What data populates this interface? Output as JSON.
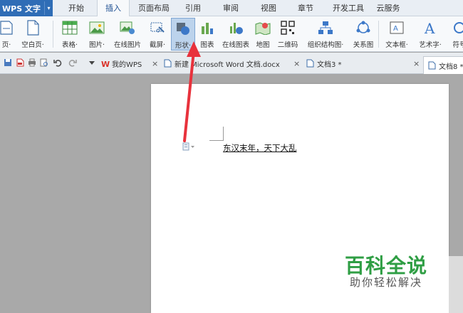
{
  "app": {
    "title": "WPS 文字"
  },
  "menu_tabs": [
    "开始",
    "插入",
    "页面布局",
    "引用",
    "审阅",
    "视图",
    "章节",
    "开发工具",
    "云服务"
  ],
  "active_menu_tab": "插入",
  "ribbon": {
    "items": [
      {
        "label": "页·"
      },
      {
        "label": "空白页·"
      },
      {
        "label": "表格·"
      },
      {
        "label": "图片·"
      },
      {
        "label": "在线图片"
      },
      {
        "label": "截屏·"
      },
      {
        "label": "形状·"
      },
      {
        "label": "图表"
      },
      {
        "label": "在线图表"
      },
      {
        "label": "地图"
      },
      {
        "label": "二维码"
      },
      {
        "label": "组织结构图·"
      },
      {
        "label": "关系图"
      },
      {
        "label": "文本框·"
      },
      {
        "label": "艺术字·"
      },
      {
        "label": "符号"
      }
    ]
  },
  "doc_tabs": [
    {
      "label": "我的WPS"
    },
    {
      "label": "新建 Microsoft Word 文档.docx"
    },
    {
      "label": "文档3 *"
    },
    {
      "label": "文档8 *"
    }
  ],
  "document": {
    "text": "东汉末年，天下大乱"
  },
  "watermark": {
    "title": "百科全说",
    "subtitle": "助你轻松解决"
  },
  "colors": {
    "accent": "#2f6db6",
    "arrow": "#e8323c",
    "watermark": "#2f9e44"
  }
}
